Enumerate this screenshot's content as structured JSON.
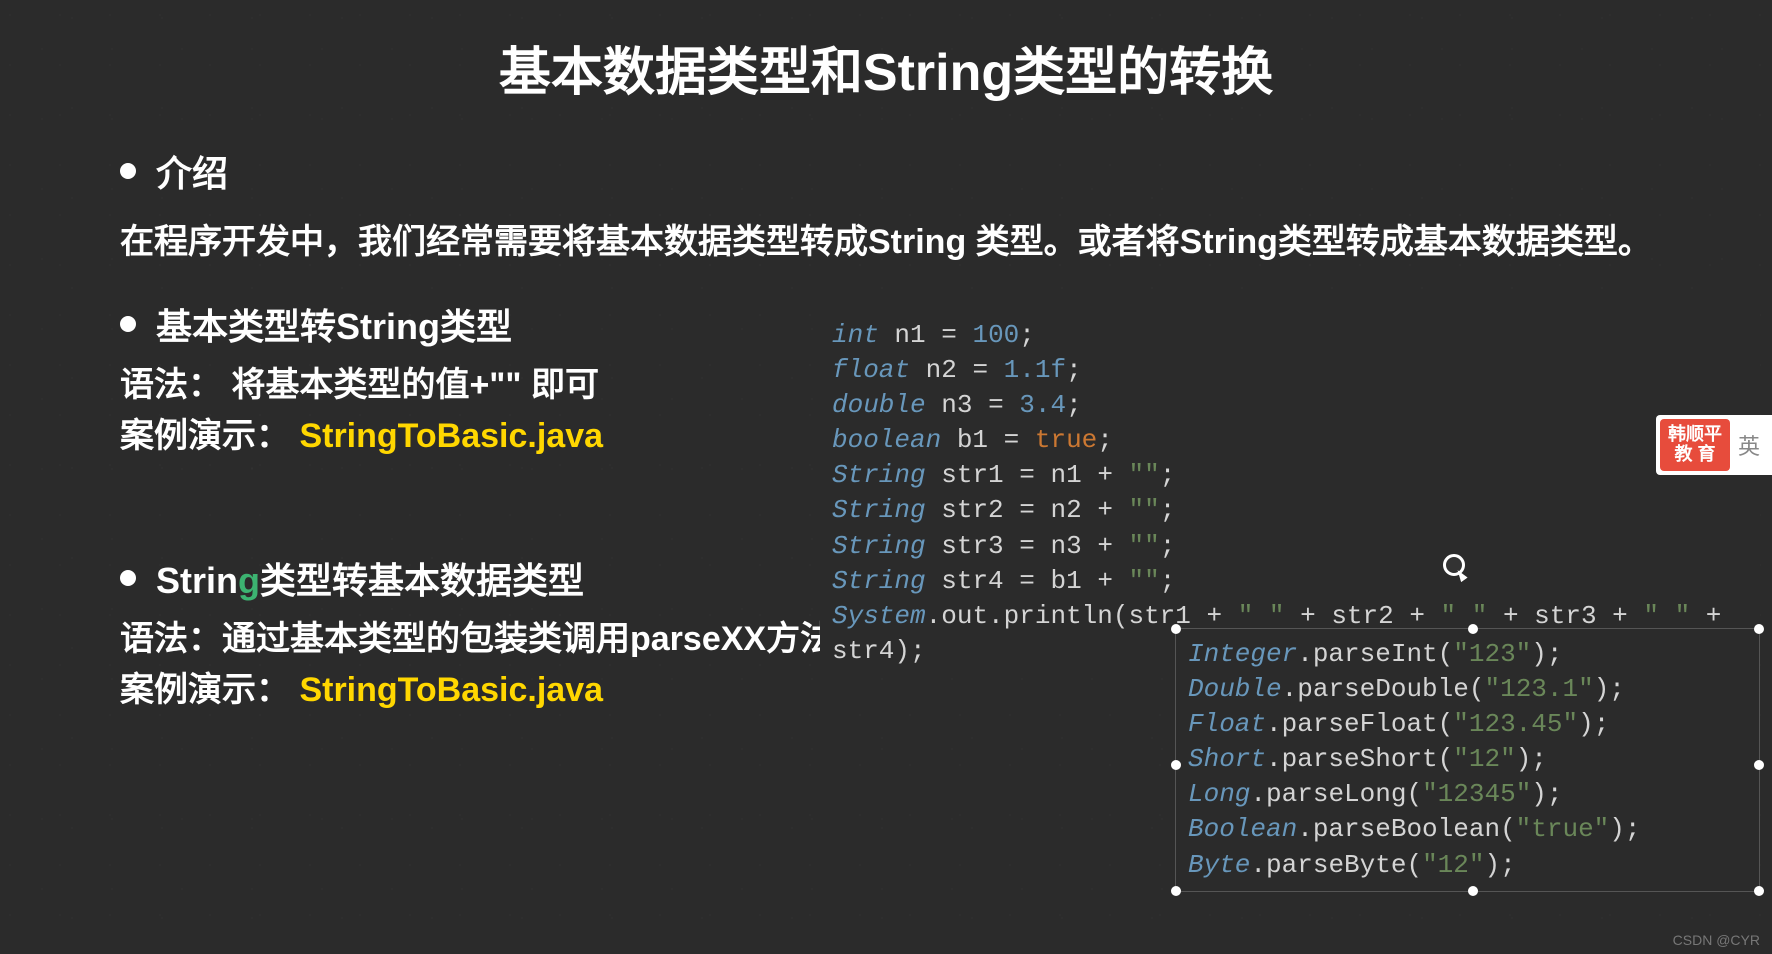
{
  "title": "基本数据类型和String类型的转换",
  "intro_label": "介绍",
  "intro_text": "在程序开发中，我们经常需要将基本数据类型转成String 类型。或者将String类型转成基本数据类型。",
  "section1": {
    "heading": "基本类型转String类型",
    "line1": "语法：  将基本类型的值+\"\" 即可",
    "line2_prefix": "案例演示：",
    "line2_file": "StringToBasic.java"
  },
  "section2": {
    "heading_pre": "Strin",
    "heading_cursor": "g",
    "heading_post": "类型转基本数据类型",
    "line1": "语法：通过基本类型的包装类调用parseXX方法即可",
    "line2_prefix": "案例演示：",
    "line2_file": "StringToBasic.java"
  },
  "code1": {
    "l1_type": "int",
    "l1_var": "n1",
    "l1_val": "100",
    "l2_type": "float",
    "l2_var": "n2",
    "l2_val": "1.1f",
    "l3_type": "double",
    "l3_var": "n3",
    "l3_val": "3.4",
    "l4_type": "boolean",
    "l4_var": "b1",
    "l4_val": "true",
    "l5_type": "String",
    "l5_var": "str1",
    "l5_rhs": "n1",
    "l5_str": "\"\"",
    "l6_type": "String",
    "l6_var": "str2",
    "l6_rhs": "n2",
    "l6_str": "\"\"",
    "l7_type": "String",
    "l7_var": "str3",
    "l7_rhs": "n3",
    "l7_str": "\"\"",
    "l8_type": "String",
    "l8_var": "str4",
    "l8_rhs": "b1",
    "l8_str": "\"\"",
    "l9_sys": "System",
    "l9_out": "out",
    "l9_method": "println",
    "l9_args": "(str1 + \" \" + str2 + \" \" + str3 + \" \" + str4);"
  },
  "code2": {
    "l1_class": "Integer",
    "l1_method": "parseInt",
    "l1_arg": "\"123\"",
    "l2_class": "Double",
    "l2_method": "parseDouble",
    "l2_arg": "\"123.1\"",
    "l3_class": "Float",
    "l3_method": "parseFloat",
    "l3_arg": "\"123.45\"",
    "l4_class": "Short",
    "l4_method": "parseShort",
    "l4_arg": "\"12\"",
    "l5_class": "Long",
    "l5_method": "parseLong",
    "l5_arg": "\"12345\"",
    "l6_class": "Boolean",
    "l6_method": "parseBoolean",
    "l6_arg": "\"true\"",
    "l7_class": "Byte",
    "l7_method": "parseByte",
    "l7_arg": "\"12\""
  },
  "badge": {
    "line1": "韩顺平",
    "line2": "教 育",
    "suffix": "英"
  },
  "watermark": "CSDN @CYR"
}
